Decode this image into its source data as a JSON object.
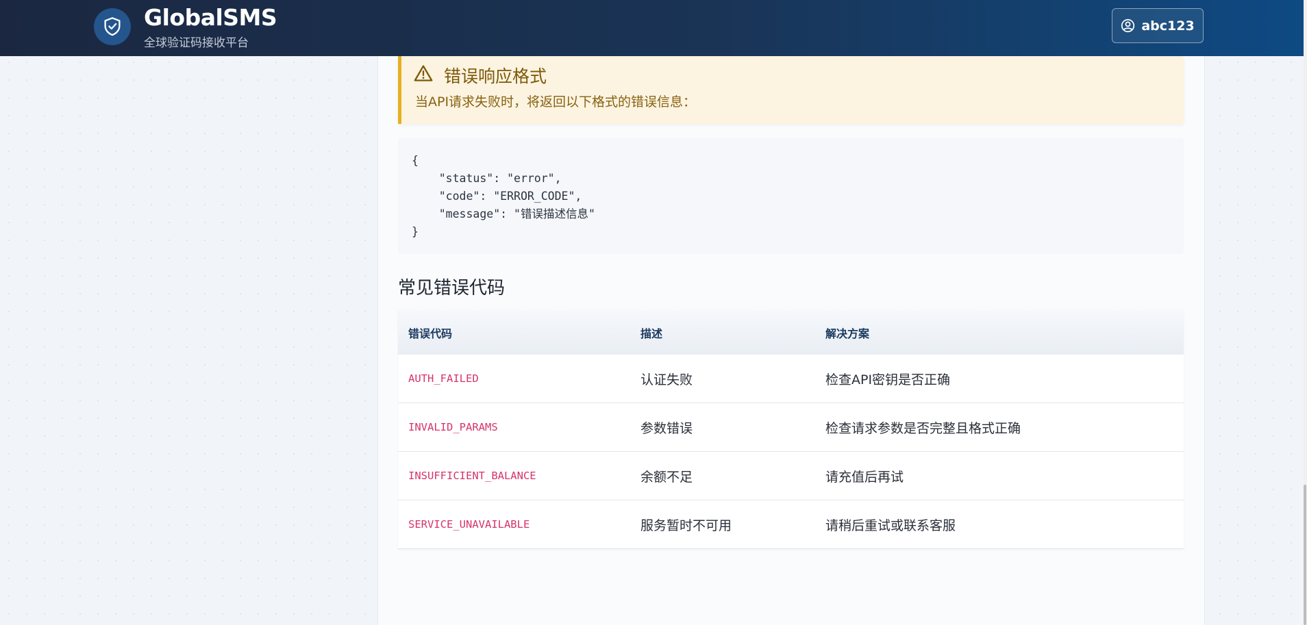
{
  "header": {
    "brand_title": "GlobalSMS",
    "brand_subtitle": "全球验证码接收平台",
    "logo_icon": "shield-check-icon",
    "user": {
      "username": "abc123",
      "icon": "user-circle-icon"
    }
  },
  "alert": {
    "icon": "warning-triangle-icon",
    "title": "错误响应格式",
    "text": "当API请求失败时，将返回以下格式的错误信息："
  },
  "code_block": {
    "lines": [
      "{",
      "    \"status\": \"error\",",
      "    \"code\": \"ERROR_CODE\",",
      "    \"message\": \"错误描述信息\"",
      "}"
    ]
  },
  "section_title": "常见错误代码",
  "table": {
    "headers": [
      "错误代码",
      "描述",
      "解决方案"
    ],
    "rows": [
      {
        "code": "AUTH_FAILED",
        "desc": "认证失败",
        "solution": "检查API密钥是否正确"
      },
      {
        "code": "INVALID_PARAMS",
        "desc": "参数错误",
        "solution": "检查请求参数是否完整且格式正确"
      },
      {
        "code": "INSUFFICIENT_BALANCE",
        "desc": "余额不足",
        "solution": "请充值后再试"
      },
      {
        "code": "SERVICE_UNAVAILABLE",
        "desc": "服务暂时不可用",
        "solution": "请稍后重试或联系客服"
      }
    ]
  },
  "colors": {
    "header_start": "#1b2740",
    "header_end": "#0e4a83",
    "alert_border": "#e6b020",
    "error_code": "#d6336c"
  }
}
